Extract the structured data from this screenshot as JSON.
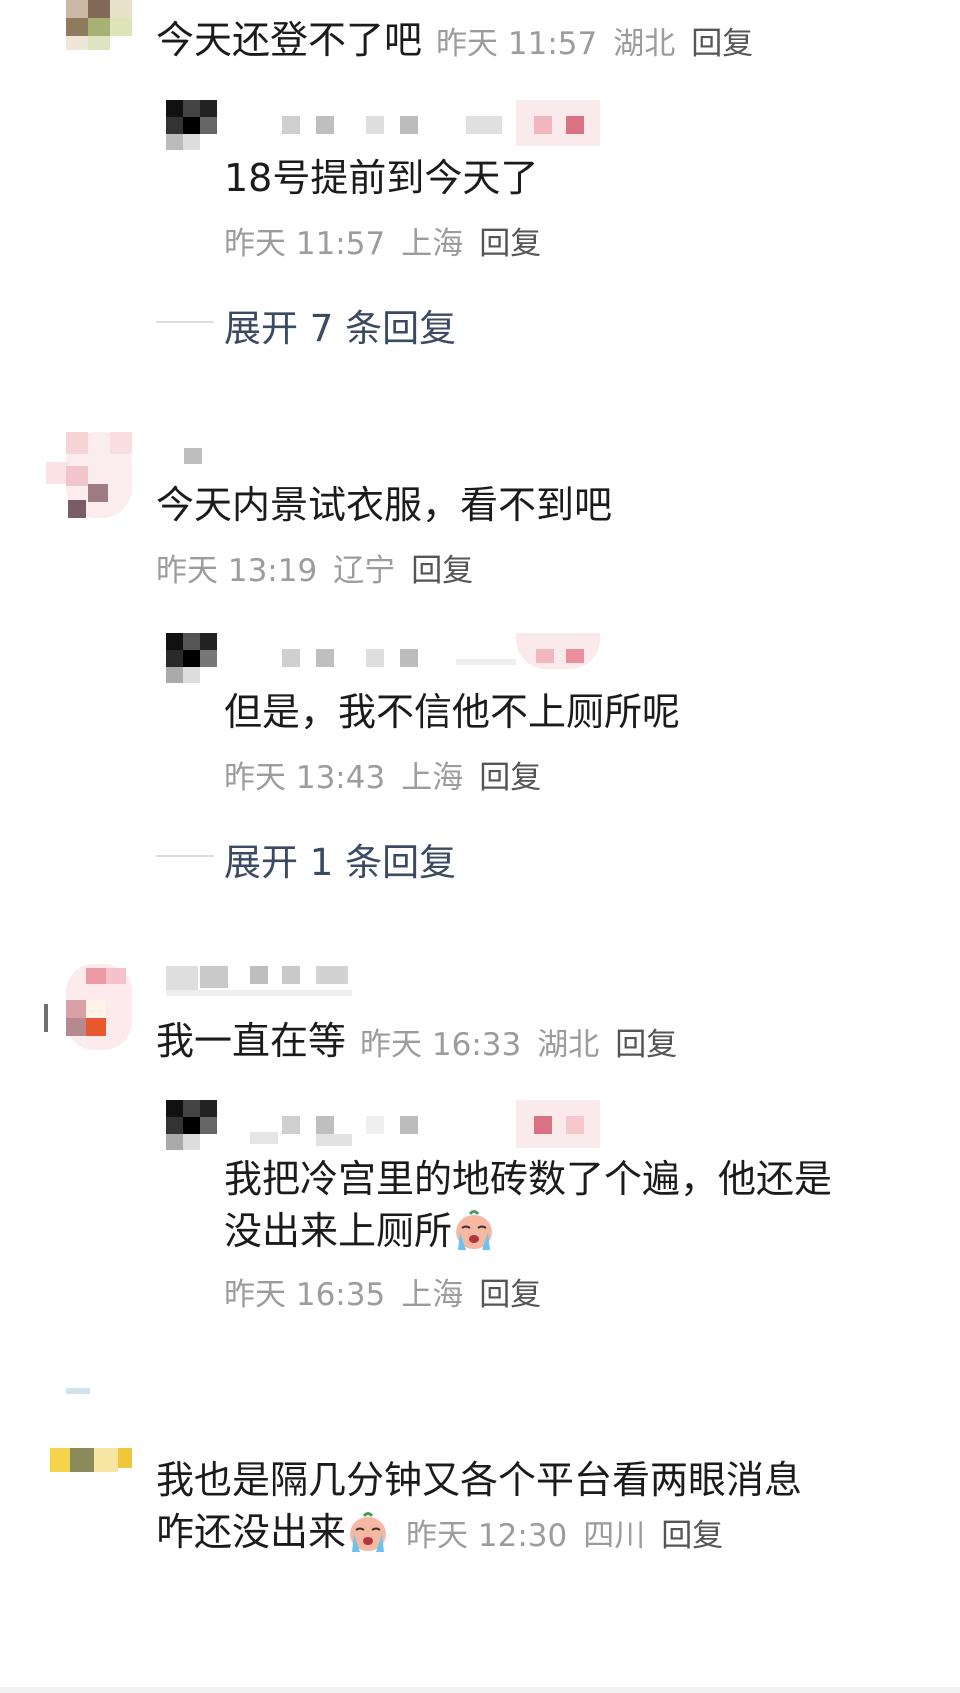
{
  "comments": [
    {
      "text": "今天还登不了吧",
      "time": "昨天 11:57",
      "location": "湖北",
      "reply_label": "回复",
      "reply": {
        "text": "18号提前到今天了",
        "time": "昨天 11:57",
        "location": "上海",
        "reply_label": "回复"
      },
      "expand_label": "展开 7 条回复"
    },
    {
      "text": "今天内景试衣服，看不到吧",
      "time": "昨天 13:19",
      "location": "辽宁",
      "reply_label": "回复",
      "reply": {
        "text": "但是，我不信他不上厕所呢",
        "time": "昨天 13:43",
        "location": "上海",
        "reply_label": "回复"
      },
      "expand_label": "展开 1 条回复"
    },
    {
      "text": "我一直在等",
      "time": "昨天 16:33",
      "location": "湖北",
      "reply_label": "回复",
      "reply": {
        "text_line1": "我把冷宫里的地砖数了个遍，他还是",
        "text_line2": "没出来上厕所",
        "emoji": "crying-face-icon",
        "time": "昨天 16:35",
        "location": "上海",
        "reply_label": "回复"
      }
    },
    {
      "text_line1": "我也是隔几分钟又各个平台看两眼消息",
      "text_line2": "咋还没出来",
      "emoji": "crying-face-icon",
      "time": "昨天 12:30",
      "location": "四川",
      "reply_label": "回复"
    }
  ],
  "colors": {
    "text": "#1b1b1b",
    "meta": "#9c9c9c",
    "reply": "#555555",
    "expand": "#3b4a63"
  }
}
